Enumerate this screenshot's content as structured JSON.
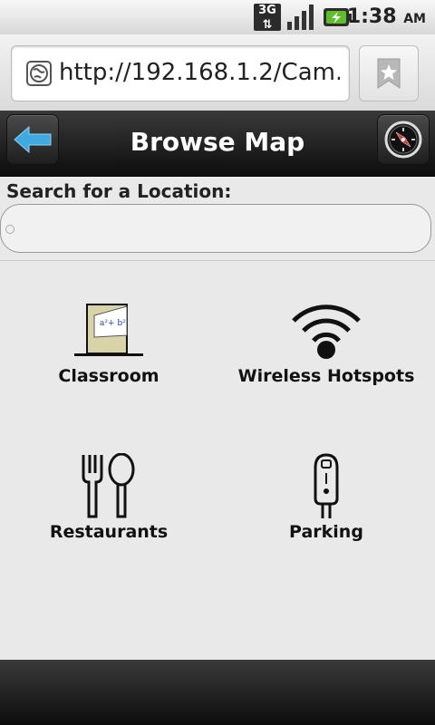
{
  "status_bar": {
    "network": "3G",
    "time": "1:38",
    "ampm": "AM",
    "icons": [
      "3g-icon",
      "signal-icon",
      "battery-charging-icon"
    ]
  },
  "browser": {
    "url": "http://192.168.1.2/Cam...",
    "icons": [
      "globe-icon",
      "bookmark-star-icon"
    ]
  },
  "header": {
    "title": "Browse Map",
    "back_icon": "back-arrow-icon",
    "compass_icon": "compass-icon"
  },
  "search": {
    "label": "Search for a Location:",
    "value": "",
    "placeholder": ""
  },
  "categories": [
    {
      "label": "Classroom",
      "icon": "classroom-board-icon",
      "board_text": "a²+ b²"
    },
    {
      "label": "Wireless Hotspots",
      "icon": "wifi-icon"
    },
    {
      "label": "Restaurants",
      "icon": "fork-spoon-icon"
    },
    {
      "label": "Parking",
      "icon": "parking-meter-icon"
    }
  ],
  "colors": {
    "header_bg": "#1a1a1a",
    "back_arrow": "#3fa9e0",
    "board_frame": "#d9d4a8"
  }
}
